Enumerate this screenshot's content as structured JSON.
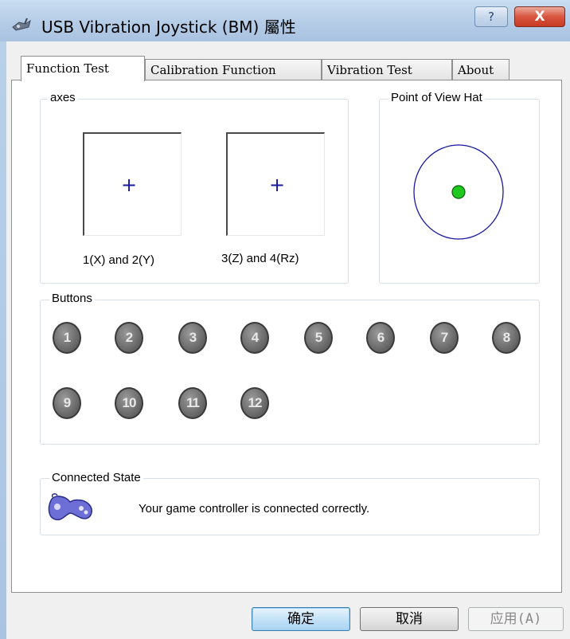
{
  "window": {
    "title": "USB Vibration Joystick (BM) 屬性",
    "help_label": "?",
    "close_label": "X"
  },
  "tabs": [
    {
      "label": "Function Test",
      "active": true
    },
    {
      "label": "Calibration Function",
      "active": false
    },
    {
      "label": "Vibration Test",
      "active": false
    },
    {
      "label": "About",
      "active": false
    }
  ],
  "axes": {
    "group_label": "axes",
    "crosshair_glyph": "+",
    "boxes": [
      {
        "label": "1(X) and 2(Y)"
      },
      {
        "label": "3(Z) and 4(Rz)"
      }
    ]
  },
  "pov": {
    "group_label": "Point of View Hat",
    "ring_color": "#1a1aa0",
    "dot_color": "#1ec81e"
  },
  "buttons": {
    "group_label": "Buttons",
    "items": [
      "1",
      "2",
      "3",
      "4",
      "5",
      "6",
      "7",
      "8",
      "9",
      "10",
      "11",
      "12"
    ]
  },
  "connection": {
    "group_label": "Connected State",
    "status": "Your game controller is connected correctly.",
    "icon": "gamepad-icon"
  },
  "dialog_buttons": {
    "ok": "确定",
    "cancel": "取消",
    "apply": "应用(A)"
  }
}
